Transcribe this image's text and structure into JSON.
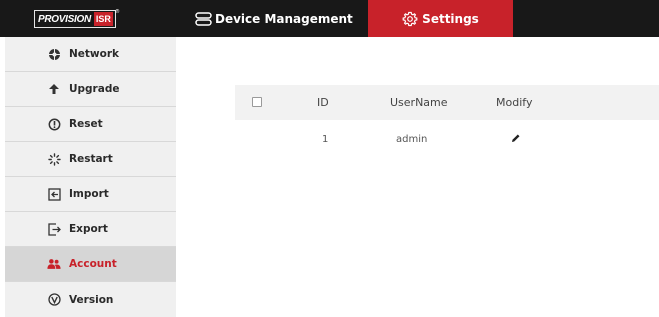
{
  "brand": {
    "logo_text": "PROVISION",
    "logo_badge": "ISR",
    "registered": "®"
  },
  "topnav": {
    "device_management": "Device Management",
    "settings": "Settings"
  },
  "sidebar": {
    "items": [
      {
        "label": "Network",
        "icon": "network-icon"
      },
      {
        "label": "Upgrade",
        "icon": "upgrade-arrow-icon"
      },
      {
        "label": "Reset",
        "icon": "reset-icon"
      },
      {
        "label": "Restart",
        "icon": "restart-spinner-icon"
      },
      {
        "label": "Import",
        "icon": "import-icon"
      },
      {
        "label": "Export",
        "icon": "export-icon"
      },
      {
        "label": "Account",
        "icon": "account-users-icon",
        "active": true
      },
      {
        "label": "Version",
        "icon": "version-icon"
      }
    ]
  },
  "table": {
    "headers": {
      "id": "ID",
      "username": "UserName",
      "modify": "Modify"
    },
    "rows": [
      {
        "id": "1",
        "username": "admin"
      }
    ]
  },
  "colors": {
    "accent": "#c8222a",
    "topbar": "#181818",
    "sidebar": "#f0f0f0"
  }
}
